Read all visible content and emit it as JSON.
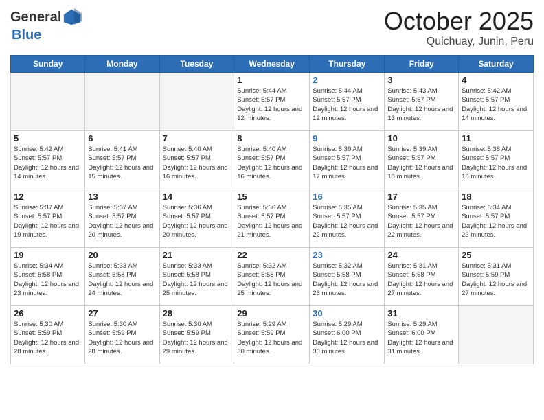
{
  "header": {
    "logo_general": "General",
    "logo_blue": "Blue",
    "month": "October 2025",
    "location": "Quichuay, Junin, Peru"
  },
  "weekdays": [
    "Sunday",
    "Monday",
    "Tuesday",
    "Wednesday",
    "Thursday",
    "Friday",
    "Saturday"
  ],
  "weeks": [
    [
      {
        "day": "",
        "info": ""
      },
      {
        "day": "",
        "info": ""
      },
      {
        "day": "",
        "info": ""
      },
      {
        "day": "1",
        "info": "Sunrise: 5:44 AM\nSunset: 5:57 PM\nDaylight: 12 hours\nand 12 minutes."
      },
      {
        "day": "2",
        "info": "Sunrise: 5:44 AM\nSunset: 5:57 PM\nDaylight: 12 hours\nand 12 minutes."
      },
      {
        "day": "3",
        "info": "Sunrise: 5:43 AM\nSunset: 5:57 PM\nDaylight: 12 hours\nand 13 minutes."
      },
      {
        "day": "4",
        "info": "Sunrise: 5:42 AM\nSunset: 5:57 PM\nDaylight: 12 hours\nand 14 minutes."
      }
    ],
    [
      {
        "day": "5",
        "info": "Sunrise: 5:42 AM\nSunset: 5:57 PM\nDaylight: 12 hours\nand 14 minutes."
      },
      {
        "day": "6",
        "info": "Sunrise: 5:41 AM\nSunset: 5:57 PM\nDaylight: 12 hours\nand 15 minutes."
      },
      {
        "day": "7",
        "info": "Sunrise: 5:40 AM\nSunset: 5:57 PM\nDaylight: 12 hours\nand 16 minutes."
      },
      {
        "day": "8",
        "info": "Sunrise: 5:40 AM\nSunset: 5:57 PM\nDaylight: 12 hours\nand 16 minutes."
      },
      {
        "day": "9",
        "info": "Sunrise: 5:39 AM\nSunset: 5:57 PM\nDaylight: 12 hours\nand 17 minutes."
      },
      {
        "day": "10",
        "info": "Sunrise: 5:39 AM\nSunset: 5:57 PM\nDaylight: 12 hours\nand 18 minutes."
      },
      {
        "day": "11",
        "info": "Sunrise: 5:38 AM\nSunset: 5:57 PM\nDaylight: 12 hours\nand 18 minutes."
      }
    ],
    [
      {
        "day": "12",
        "info": "Sunrise: 5:37 AM\nSunset: 5:57 PM\nDaylight: 12 hours\nand 19 minutes."
      },
      {
        "day": "13",
        "info": "Sunrise: 5:37 AM\nSunset: 5:57 PM\nDaylight: 12 hours\nand 20 minutes."
      },
      {
        "day": "14",
        "info": "Sunrise: 5:36 AM\nSunset: 5:57 PM\nDaylight: 12 hours\nand 20 minutes."
      },
      {
        "day": "15",
        "info": "Sunrise: 5:36 AM\nSunset: 5:57 PM\nDaylight: 12 hours\nand 21 minutes."
      },
      {
        "day": "16",
        "info": "Sunrise: 5:35 AM\nSunset: 5:57 PM\nDaylight: 12 hours\nand 22 minutes."
      },
      {
        "day": "17",
        "info": "Sunrise: 5:35 AM\nSunset: 5:57 PM\nDaylight: 12 hours\nand 22 minutes."
      },
      {
        "day": "18",
        "info": "Sunrise: 5:34 AM\nSunset: 5:57 PM\nDaylight: 12 hours\nand 23 minutes."
      }
    ],
    [
      {
        "day": "19",
        "info": "Sunrise: 5:34 AM\nSunset: 5:58 PM\nDaylight: 12 hours\nand 23 minutes."
      },
      {
        "day": "20",
        "info": "Sunrise: 5:33 AM\nSunset: 5:58 PM\nDaylight: 12 hours\nand 24 minutes."
      },
      {
        "day": "21",
        "info": "Sunrise: 5:33 AM\nSunset: 5:58 PM\nDaylight: 12 hours\nand 25 minutes."
      },
      {
        "day": "22",
        "info": "Sunrise: 5:32 AM\nSunset: 5:58 PM\nDaylight: 12 hours\nand 25 minutes."
      },
      {
        "day": "23",
        "info": "Sunrise: 5:32 AM\nSunset: 5:58 PM\nDaylight: 12 hours\nand 26 minutes."
      },
      {
        "day": "24",
        "info": "Sunrise: 5:31 AM\nSunset: 5:58 PM\nDaylight: 12 hours\nand 27 minutes."
      },
      {
        "day": "25",
        "info": "Sunrise: 5:31 AM\nSunset: 5:59 PM\nDaylight: 12 hours\nand 27 minutes."
      }
    ],
    [
      {
        "day": "26",
        "info": "Sunrise: 5:30 AM\nSunset: 5:59 PM\nDaylight: 12 hours\nand 28 minutes."
      },
      {
        "day": "27",
        "info": "Sunrise: 5:30 AM\nSunset: 5:59 PM\nDaylight: 12 hours\nand 28 minutes."
      },
      {
        "day": "28",
        "info": "Sunrise: 5:30 AM\nSunset: 5:59 PM\nDaylight: 12 hours\nand 29 minutes."
      },
      {
        "day": "29",
        "info": "Sunrise: 5:29 AM\nSunset: 5:59 PM\nDaylight: 12 hours\nand 30 minutes."
      },
      {
        "day": "30",
        "info": "Sunrise: 5:29 AM\nSunset: 6:00 PM\nDaylight: 12 hours\nand 30 minutes."
      },
      {
        "day": "31",
        "info": "Sunrise: 5:29 AM\nSunset: 6:00 PM\nDaylight: 12 hours\nand 31 minutes."
      },
      {
        "day": "",
        "info": ""
      }
    ]
  ]
}
